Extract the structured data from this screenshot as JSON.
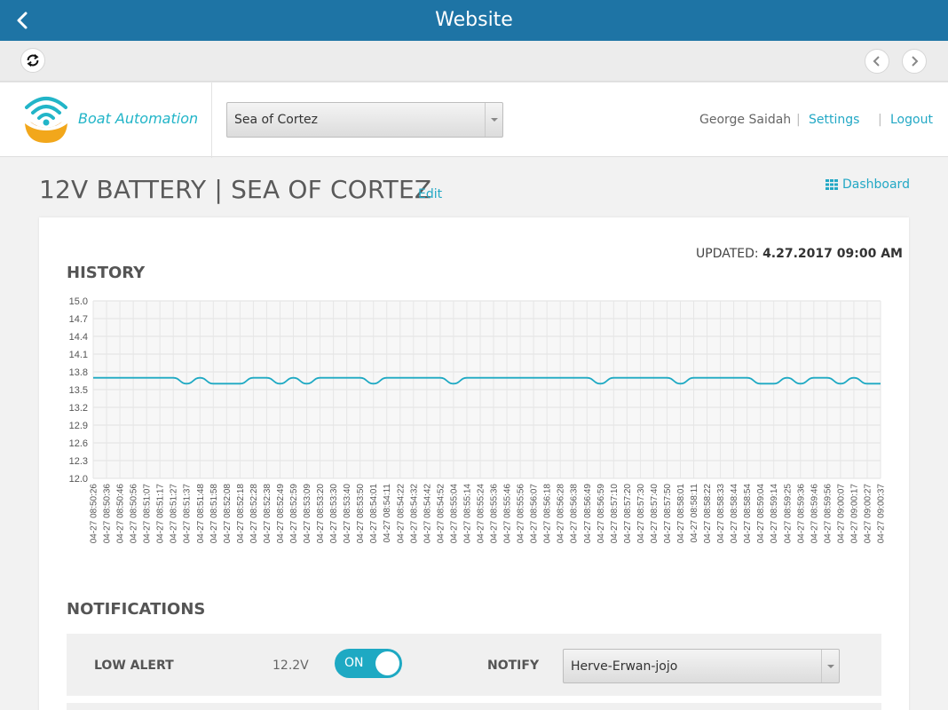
{
  "window": {
    "title": "Website"
  },
  "header": {
    "brand": "Boat Automation",
    "vessel_select": "Sea of Cortez",
    "user_name": "George Saidah",
    "settings_label": "Settings",
    "logout_label": "Logout",
    "separator": "|"
  },
  "page": {
    "title": "12V BATTERY | SEA OF CORTEZ",
    "edit_label": "Edit",
    "dashboard_label": "Dashboard",
    "updated_label": "UPDATED:",
    "updated_value": "4.27.2017 09:00 AM",
    "history_heading": "HISTORY",
    "notifications_heading": "NOTIFICATIONS"
  },
  "notification": {
    "label": "LOW ALERT",
    "threshold": "12.2V",
    "toggle_label": "ON",
    "toggle_on": true,
    "notify_label": "NOTIFY",
    "notify_select": "Herve-Erwan-jojo"
  },
  "colors": {
    "accent": "#22a8c5",
    "topbar": "#1e74a5",
    "line": "#1ea9c3"
  },
  "chart_data": {
    "type": "line",
    "ylim": [
      12.0,
      15.0
    ],
    "yticks": [
      "15.0",
      "14.7",
      "14.4",
      "14.1",
      "13.8",
      "13.5",
      "13.2",
      "12.9",
      "12.6",
      "12.3",
      "12.0"
    ],
    "grid": true,
    "x": [
      "04-27 08:50:26",
      "04-27 08:50:36",
      "04-27 08:50:46",
      "04-27 08:50:56",
      "04-27 08:51:07",
      "04-27 08:51:17",
      "04-27 08:51:27",
      "04-27 08:51:37",
      "04-27 08:51:48",
      "04-27 08:51:58",
      "04-27 08:52:08",
      "04-27 08:52:18",
      "04-27 08:52:28",
      "04-27 08:52:38",
      "04-27 08:52:49",
      "04-27 08:52:59",
      "04-27 08:53:09",
      "04-27 08:53:20",
      "04-27 08:53:30",
      "04-27 08:53:40",
      "04-27 08:53:50",
      "04-27 08:54:01",
      "04-27 08:54:11",
      "04-27 08:54:22",
      "04-27 08:54:32",
      "04-27 08:54:42",
      "04-27 08:54:52",
      "04-27 08:55:04",
      "04-27 08:55:14",
      "04-27 08:55:24",
      "04-27 08:55:36",
      "04-27 08:55:46",
      "04-27 08:55:56",
      "04-27 08:56:07",
      "04-27 08:56:18",
      "04-27 08:56:28",
      "04-27 08:56:38",
      "04-27 08:56:49",
      "04-27 08:56:59",
      "04-27 08:57:10",
      "04-27 08:57:20",
      "04-27 08:57:30",
      "04-27 08:57:40",
      "04-27 08:57:50",
      "04-27 08:58:01",
      "04-27 08:58:11",
      "04-27 08:58:22",
      "04-27 08:58:33",
      "04-27 08:58:44",
      "04-27 08:58:54",
      "04-27 08:59:04",
      "04-27 08:59:14",
      "04-27 08:59:25",
      "04-27 08:59:36",
      "04-27 08:59:46",
      "04-27 08:59:56",
      "04-27 09:00:07",
      "04-27 09:00:17",
      "04-27 09:00:27",
      "04-27 09:00:37"
    ],
    "values": [
      13.7,
      13.7,
      13.7,
      13.7,
      13.7,
      13.7,
      13.7,
      13.6,
      13.7,
      13.6,
      13.6,
      13.6,
      13.7,
      13.7,
      13.6,
      13.7,
      13.6,
      13.7,
      13.7,
      13.7,
      13.7,
      13.6,
      13.7,
      13.7,
      13.7,
      13.7,
      13.7,
      13.6,
      13.7,
      13.7,
      13.7,
      13.7,
      13.7,
      13.7,
      13.7,
      13.7,
      13.7,
      13.7,
      13.6,
      13.7,
      13.7,
      13.7,
      13.7,
      13.7,
      13.6,
      13.7,
      13.7,
      13.7,
      13.7,
      13.7,
      13.6,
      13.6,
      13.7,
      13.6,
      13.7,
      13.7,
      13.6,
      13.7,
      13.6,
      13.6
    ]
  }
}
